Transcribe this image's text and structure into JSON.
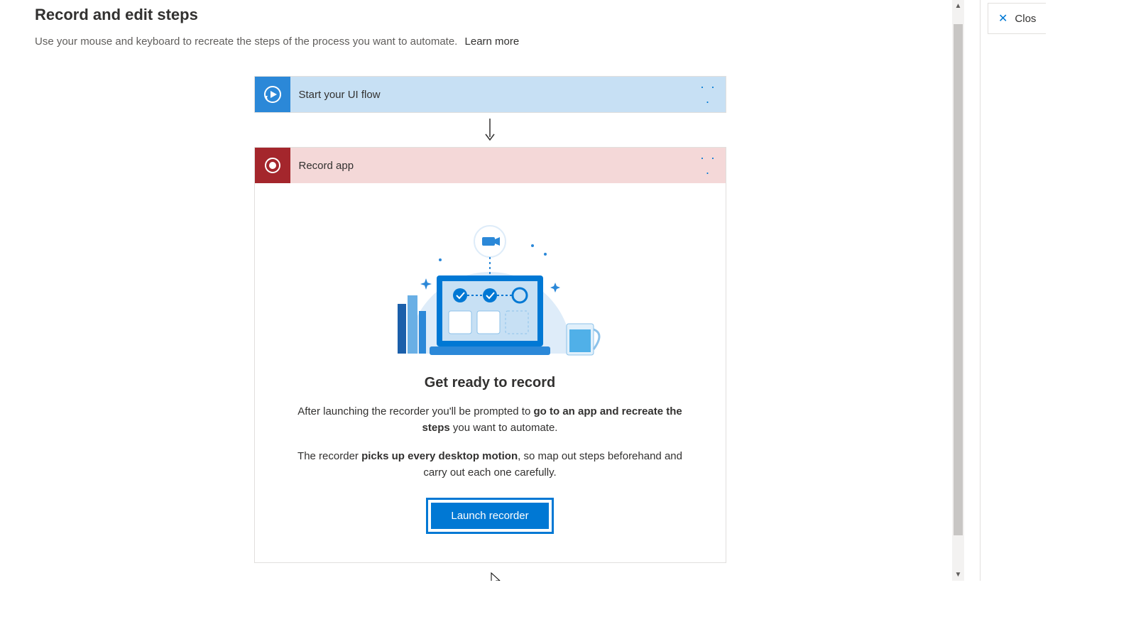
{
  "header": {
    "title": "Record and edit steps",
    "subtitle": "Use your mouse and keyboard to recreate the steps of the process you want to automate.",
    "learn_more": "Learn more"
  },
  "flow": {
    "start_step": {
      "label": "Start your UI flow",
      "menu": "· · ·"
    },
    "record_step": {
      "label": "Record app",
      "menu": "· · ·",
      "heading": "Get ready to record",
      "para1_pre": "After launching the recorder you'll be prompted to ",
      "para1_bold": "go to an app and recreate the steps",
      "para1_post": " you want to automate.",
      "para2_pre": "The recorder ",
      "para2_bold": "picks up every desktop motion",
      "para2_post": ", so map out steps beforehand and carry out each one carefully.",
      "launch_button": "Launch recorder"
    }
  },
  "right_panel": {
    "close_label": "Clos"
  }
}
